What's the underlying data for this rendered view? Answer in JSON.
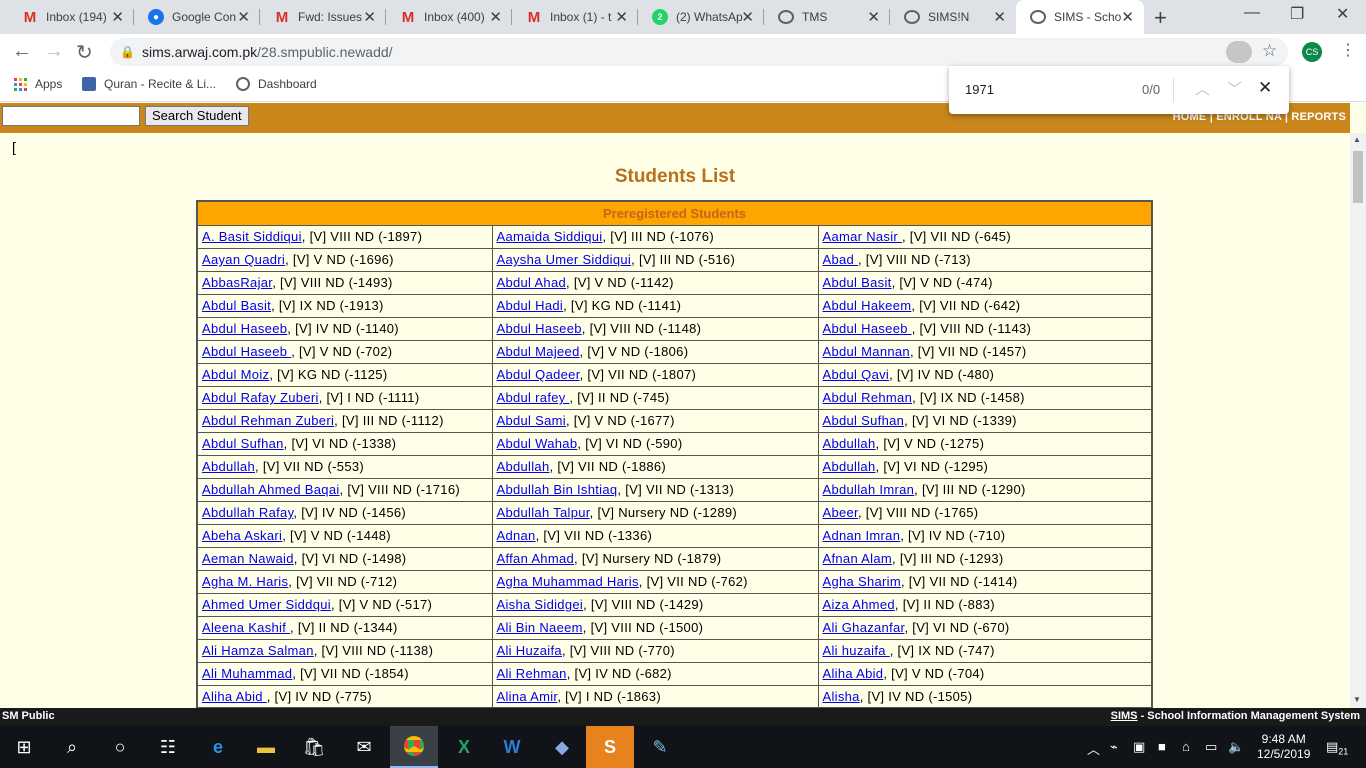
{
  "browser": {
    "tabs": [
      {
        "title": "Inbox (194)",
        "icon": "gmail-icon"
      },
      {
        "title": "Google Con",
        "icon": "google-contacts-icon"
      },
      {
        "title": "Fwd: Issues",
        "icon": "gmail-icon"
      },
      {
        "title": "Inbox (400)",
        "icon": "gmail-icon"
      },
      {
        "title": "Inbox (1) - t",
        "icon": "gmail-icon"
      },
      {
        "title": "(2) WhatsAp",
        "icon": "whatsapp-icon"
      },
      {
        "title": "TMS",
        "icon": "globe-icon"
      },
      {
        "title": "SIMS!N",
        "icon": "globe-icon"
      },
      {
        "title": "SIMS - Scho",
        "icon": "globe-icon"
      }
    ],
    "url_host": "sims.arwaj.com.pk",
    "url_path": "/28.smpublic.newadd/",
    "profile_initials": "CS",
    "bookmarks": [
      "Apps",
      "Quran - Recite & Li...",
      "Dashboard"
    ],
    "find": {
      "query": "1971",
      "count": "0/0"
    }
  },
  "page": {
    "search_button": "Search Student",
    "nav": {
      "home": "HOME",
      "enroll": "ENROLL NA",
      "reports": "REPORTS",
      "sep": "|"
    },
    "bracket": "[",
    "title": "Students List",
    "table_header": "Preregistered Students",
    "rows": [
      [
        {
          "name": "A. Basit Siddiqui",
          "info": ", [V] VIII ND (-1897)"
        },
        {
          "name": "Aamaida Siddiqui",
          "info": ", [V] III ND (-1076)"
        },
        {
          "name": "Aamar Nasir ",
          "info": ", [V] VII ND (-645)"
        }
      ],
      [
        {
          "name": "Aayan Quadri",
          "info": ", [V] V ND (-1696)"
        },
        {
          "name": "Aaysha Umer Siddiqui",
          "info": ", [V] III ND (-516)"
        },
        {
          "name": "Abad ",
          "info": ", [V] VIII ND (-713)"
        }
      ],
      [
        {
          "name": "AbbasRajar",
          "info": ", [V] VIII ND (-1493)"
        },
        {
          "name": "Abdul Ahad",
          "info": ", [V] V ND (-1142)"
        },
        {
          "name": "Abdul Basit",
          "info": ", [V] V ND (-474)"
        }
      ],
      [
        {
          "name": "Abdul Basit",
          "info": ", [V] IX ND (-1913)"
        },
        {
          "name": "Abdul Hadi",
          "info": ", [V] KG ND (-1141)"
        },
        {
          "name": "Abdul Hakeem",
          "info": ", [V] VII ND (-642)"
        }
      ],
      [
        {
          "name": "Abdul Haseeb",
          "info": ", [V] IV ND (-1140)"
        },
        {
          "name": "Abdul Haseeb",
          "info": ", [V] VIII ND (-1148)"
        },
        {
          "name": "Abdul Haseeb ",
          "info": ", [V] VIII ND (-1143)"
        }
      ],
      [
        {
          "name": "Abdul Haseeb ",
          "info": ", [V] V ND (-702)"
        },
        {
          "name": "Abdul Majeed",
          "info": ", [V] V ND (-1806)"
        },
        {
          "name": "Abdul Mannan",
          "info": ", [V] VII ND (-1457)"
        }
      ],
      [
        {
          "name": "Abdul Moiz",
          "info": ", [V] KG ND (-1125)"
        },
        {
          "name": "Abdul Qadeer",
          "info": ", [V] VII ND (-1807)"
        },
        {
          "name": "Abdul Qavi",
          "info": ", [V] IV ND (-480)"
        }
      ],
      [
        {
          "name": "Abdul Rafay Zuberi",
          "info": ", [V] I ND (-1111)"
        },
        {
          "name": "Abdul rafey ",
          "info": ", [V] II ND (-745)"
        },
        {
          "name": "Abdul Rehman",
          "info": ", [V] IX ND (-1458)"
        }
      ],
      [
        {
          "name": "Abdul Rehman Zuberi",
          "info": ", [V] III ND (-1112)"
        },
        {
          "name": "Abdul Sami",
          "info": ", [V] V ND (-1677)"
        },
        {
          "name": "Abdul Sufhan",
          "info": ", [V] VI ND (-1339)"
        }
      ],
      [
        {
          "name": "Abdul Sufhan",
          "info": ", [V] VI ND (-1338)"
        },
        {
          "name": "Abdul Wahab",
          "info": ", [V] VI ND (-590)"
        },
        {
          "name": "Abdullah",
          "info": ", [V] V ND (-1275)"
        }
      ],
      [
        {
          "name": "Abdullah",
          "info": ", [V] VII ND (-553)"
        },
        {
          "name": "Abdullah",
          "info": ", [V] VII ND (-1886)"
        },
        {
          "name": "Abdullah",
          "info": ", [V] VI ND (-1295)"
        }
      ],
      [
        {
          "name": "Abdullah Ahmed Baqai",
          "info": ", [V] VIII ND (-1716)"
        },
        {
          "name": "Abdullah Bin Ishtiaq",
          "info": ", [V] VII ND (-1313)"
        },
        {
          "name": "Abdullah Imran",
          "info": ", [V] III ND (-1290)"
        }
      ],
      [
        {
          "name": "Abdullah Rafay",
          "info": ", [V] IV ND (-1456)"
        },
        {
          "name": "Abdullah Talpur",
          "info": ", [V] Nursery ND (-1289)"
        },
        {
          "name": "Abeer",
          "info": ", [V] VIII ND (-1765)"
        }
      ],
      [
        {
          "name": "Abeha Askari",
          "info": ", [V] V ND (-1448)"
        },
        {
          "name": "Adnan",
          "info": ", [V] VII ND (-1336)"
        },
        {
          "name": "Adnan Imran",
          "info": ", [V] IV ND (-710)"
        }
      ],
      [
        {
          "name": "Aeman Nawaid",
          "info": ", [V] VI ND (-1498)"
        },
        {
          "name": "Affan Ahmad",
          "info": ", [V] Nursery ND (-1879)"
        },
        {
          "name": "Afnan Alam",
          "info": ", [V] III ND (-1293)"
        }
      ],
      [
        {
          "name": "Agha M. Haris",
          "info": ", [V] VII ND (-712)"
        },
        {
          "name": "Agha Muhammad Haris",
          "info": ", [V] VII ND (-762)"
        },
        {
          "name": "Agha Sharim",
          "info": ", [V] VII ND (-1414)"
        }
      ],
      [
        {
          "name": "Ahmed Umer Siddqui",
          "info": ", [V] V ND (-517)"
        },
        {
          "name": "Aisha Sididgei",
          "info": ", [V] VIII ND (-1429)"
        },
        {
          "name": "Aiza Ahmed",
          "info": ", [V] II ND (-883)"
        }
      ],
      [
        {
          "name": "Aleena Kashif ",
          "info": ", [V] II ND (-1344)"
        },
        {
          "name": "Ali Bin Naeem",
          "info": ", [V] VIII ND (-1500)"
        },
        {
          "name": "Ali Ghazanfar",
          "info": ", [V] VI ND (-670)"
        }
      ],
      [
        {
          "name": "Ali Hamza Salman",
          "info": ", [V] VIII ND (-1138)"
        },
        {
          "name": "Ali Huzaifa",
          "info": ", [V] VIII ND (-770)"
        },
        {
          "name": "Ali huzaifa ",
          "info": ", [V] IX ND (-747)"
        }
      ],
      [
        {
          "name": "Ali Muhammad",
          "info": ", [V] VII ND (-1854)"
        },
        {
          "name": "Ali Rehman",
          "info": ", [V] IV ND (-682)"
        },
        {
          "name": "Aliha Abid",
          "info": ", [V] V ND (-704)"
        }
      ],
      [
        {
          "name": "Aliha Abid ",
          "info": ", [V] IV ND (-775)"
        },
        {
          "name": "Alina Amir",
          "info": ", [V] I ND (-1863)"
        },
        {
          "name": "Alisha",
          "info": ", [V] IV ND (-1505)"
        }
      ]
    ],
    "footer_left": "SM Public",
    "footer_right_link": "SIMS",
    "footer_right_text": " - School Information Management System"
  },
  "taskbar": {
    "time": "9:48 AM",
    "date": "12/5/2019",
    "notifications": "21",
    "apps": [
      "windows-start-icon",
      "search-icon",
      "cortana-icon",
      "task-view-icon",
      "edge-icon",
      "file-explorer-icon",
      "store-icon",
      "mail-icon",
      "chrome-icon",
      "excel-icon",
      "word-icon",
      "dolphin-icon",
      "skype-icon",
      "paint-icon"
    ]
  },
  "colors": {
    "band": "#c9861b",
    "header_orange": "#ffa500",
    "title": "#b7701b",
    "page_bg": "#ffffe8",
    "link": "#0000ee"
  }
}
